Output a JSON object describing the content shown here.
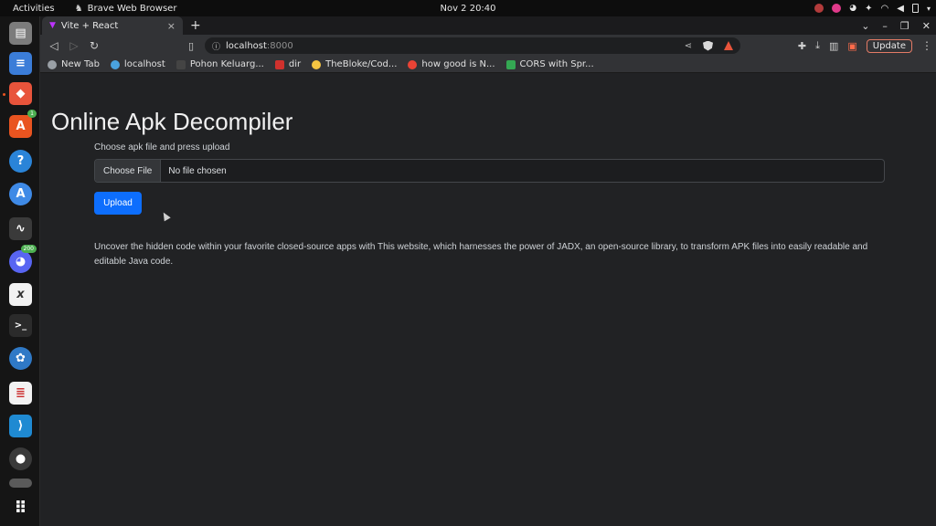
{
  "topbar": {
    "activities": "Activities",
    "app_name": "Brave Web Browser",
    "clock": "Nov 2  20:40"
  },
  "dock": {
    "apps": [
      {
        "name": "files",
        "glyph": "▤",
        "color": "#7c7c7c"
      },
      {
        "name": "docs",
        "glyph": "≡",
        "color": "#3b7dd8"
      },
      {
        "name": "brave",
        "glyph": "◆",
        "color": "#e8543b"
      },
      {
        "name": "software",
        "glyph": "A",
        "color": "#e95420",
        "badge": "1"
      },
      {
        "name": "help",
        "glyph": "?",
        "color": "#2a84d8"
      },
      {
        "name": "appcenter",
        "glyph": "A",
        "color": "#3f8ae6"
      },
      {
        "name": "monitor",
        "glyph": "∿",
        "color": "#3a3a3a"
      },
      {
        "name": "discord",
        "glyph": "◕",
        "color": "#5865f2",
        "badge": "200"
      },
      {
        "name": "xournal",
        "glyph": "x",
        "color": "#f2f2f2"
      },
      {
        "name": "terminal",
        "glyph": ">_",
        "color": "#2b2b2b"
      },
      {
        "name": "kdeconnect",
        "glyph": "✿",
        "color": "#2f79c6"
      },
      {
        "name": "text-editor",
        "glyph": "≣",
        "color": "#f2f2f2"
      },
      {
        "name": "vscode",
        "glyph": "⟩",
        "color": "#1f8ad2"
      },
      {
        "name": "obs",
        "glyph": "●",
        "color": "#3a3a3a"
      },
      {
        "name": "drive",
        "glyph": "▬",
        "color": "#5a5a5a"
      },
      {
        "name": "show-apps",
        "glyph": "⠿",
        "color": "#151515"
      }
    ]
  },
  "browser": {
    "tab_title": "Vite + React",
    "url_host": "localhost",
    "url_port": ":8000",
    "update_label": "Update",
    "bookmarks": [
      {
        "label": "New Tab",
        "color": "#9aa0a6"
      },
      {
        "label": "localhost",
        "color": "#4aa3df"
      },
      {
        "label": "Pohon Keluarg...",
        "color": "#444444"
      },
      {
        "label": "dir",
        "color": "#d0312d"
      },
      {
        "label": "TheBloke/Cod...",
        "color": "#f5c542"
      },
      {
        "label": "how good is N...",
        "color": "#ea4335"
      },
      {
        "label": "CORS with Spr...",
        "color": "#34a853"
      }
    ]
  },
  "page": {
    "title": "Online Apk Decompiler",
    "upload_label": "Choose apk file and press upload",
    "choose_file_label": "Choose File",
    "file_status": "No file chosen",
    "upload_button": "Upload",
    "description": "Uncover the hidden code within your favorite closed-source apps with This website, which harnesses the power of JADX, an open-source library, to transform APK files into easily readable and editable Java code."
  }
}
